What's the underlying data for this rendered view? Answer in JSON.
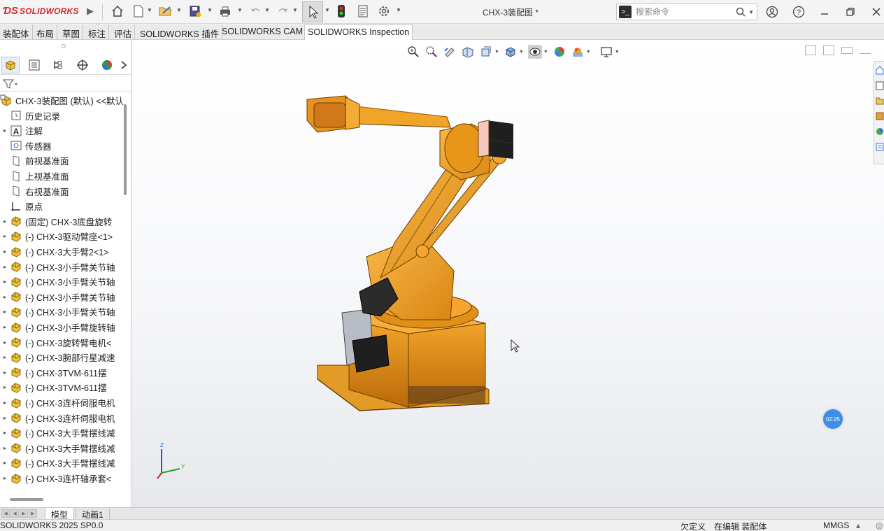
{
  "app": {
    "brand": "SOLIDWORKS",
    "doc_title": "CHX-3装配图 *"
  },
  "search": {
    "placeholder": "搜索命令"
  },
  "tabs": [
    {
      "label": "装配体"
    },
    {
      "label": "布局"
    },
    {
      "label": "草图"
    },
    {
      "label": "标注"
    },
    {
      "label": "评估"
    },
    {
      "label": "SOLIDWORKS 插件"
    },
    {
      "label": "SOLIDWORKS CAM"
    },
    {
      "label": "SOLIDWORKS Inspection"
    }
  ],
  "tree": {
    "root": "CHX-3装配图 (默认) <<默认",
    "items": [
      {
        "label": "历史记录",
        "icon": "history-icon",
        "caret": false
      },
      {
        "label": "注解",
        "icon": "annotation-icon",
        "caret": true
      },
      {
        "label": "传感器",
        "icon": "sensor-icon",
        "caret": false
      },
      {
        "label": "前视基准面",
        "icon": "plane-icon",
        "caret": false
      },
      {
        "label": "上视基准面",
        "icon": "plane-icon",
        "caret": false
      },
      {
        "label": "右视基准面",
        "icon": "plane-icon",
        "caret": false
      },
      {
        "label": "原点",
        "icon": "origin-icon",
        "caret": false
      },
      {
        "label": "(固定) CHX-3底盘旋转",
        "icon": "part-icon",
        "caret": true
      },
      {
        "label": "(-) CHX-3驱动臂座<1>",
        "icon": "part-icon",
        "caret": true
      },
      {
        "label": "(-) CHX-3大手臂2<1>",
        "icon": "part-icon",
        "caret": true
      },
      {
        "label": "(-) CHX-3小手臂关节轴",
        "icon": "part-icon",
        "caret": true
      },
      {
        "label": "(-) CHX-3小手臂关节轴",
        "icon": "part-icon",
        "caret": true
      },
      {
        "label": "(-) CHX-3小手臂关节轴",
        "icon": "part-icon",
        "caret": true
      },
      {
        "label": "(-) CHX-3小手臂关节轴",
        "icon": "part-icon",
        "caret": true
      },
      {
        "label": "(-) CHX-3小手臂旋转轴",
        "icon": "part-icon",
        "caret": true
      },
      {
        "label": "(-) CHX-3旋转臂电机<",
        "icon": "part-icon",
        "caret": true
      },
      {
        "label": "(-) CHX-3腕部行星减速",
        "icon": "part-icon",
        "caret": true
      },
      {
        "label": "(-) CHX-3TVM-611摆",
        "icon": "part-icon",
        "caret": true
      },
      {
        "label": "(-) CHX-3TVM-611摆",
        "icon": "part-icon",
        "caret": true
      },
      {
        "label": "(-) CHX-3连杆伺服电机",
        "icon": "part-icon",
        "caret": true
      },
      {
        "label": "(-) CHX-3连杆伺服电机",
        "icon": "part-icon",
        "caret": true
      },
      {
        "label": "(-) CHX-3大手臂摆线减",
        "icon": "part-icon",
        "caret": true
      },
      {
        "label": "(-) CHX-3大手臂摆线减",
        "icon": "part-icon",
        "caret": true
      },
      {
        "label": "(-) CHX-3大手臂摆线减",
        "icon": "part-icon",
        "caret": true
      },
      {
        "label": "(-) CHX-3连杆轴承套<",
        "icon": "part-icon",
        "caret": true
      }
    ]
  },
  "bottom_tabs": [
    {
      "label": "模型"
    },
    {
      "label": "动画1"
    }
  ],
  "status": {
    "version": "SOLIDWORKS 2025 SP0.0",
    "defined": "欠定义",
    "editing": "在编辑 装配体",
    "units": "MMGS"
  },
  "timer": "02:25",
  "triad": {
    "z": "Z",
    "y": "Y"
  },
  "colors": {
    "brand_red": "#d8262c",
    "robot_orange": "#f0a020",
    "robot_dark": "#2a2a2a",
    "timer_blue": "#3c8ee8"
  }
}
